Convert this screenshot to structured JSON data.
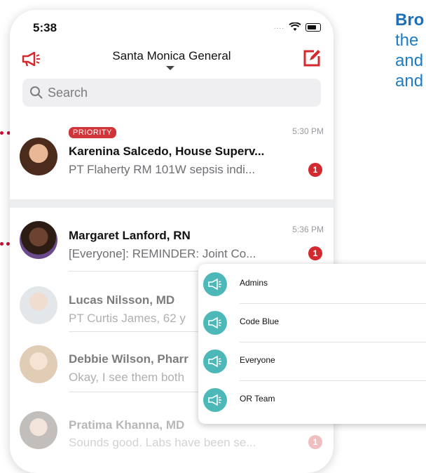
{
  "status": {
    "time": "5:38",
    "signal": "...."
  },
  "header": {
    "title": "Santa Monica General"
  },
  "search": {
    "placeholder": "Search"
  },
  "conversations": [
    {
      "tag": "PRIORITY",
      "name": "Karenina Salcedo, House Superv...",
      "preview": "PT Flaherty RM 101W sepsis indi...",
      "time": "5:30 PM",
      "unread": "1"
    },
    {
      "name": "Margaret Lanford, RN",
      "preview": "[Everyone]: REMINDER: Joint Co...",
      "time": "5:36 PM",
      "unread": "1"
    },
    {
      "name": "Lucas Nilsson, MD",
      "preview": "PT Curtis James, 62 y"
    },
    {
      "name": "Debbie Wilson, Pharr",
      "preview": "Okay, I see them both"
    },
    {
      "name": "Pratima Khanna, MD",
      "preview": "Sounds good. Labs have been se...",
      "unread": "1"
    }
  ],
  "broadcast_lists": [
    {
      "label": "Admins"
    },
    {
      "label": "Code Blue"
    },
    {
      "label": "Everyone"
    },
    {
      "label": "OR Team"
    }
  ],
  "side_text": {
    "line1": "Bro",
    "line2": "the",
    "line3": "and",
    "line4": "and"
  },
  "colors": {
    "accent_red": "#d32a2f",
    "teal": "#4db8b8",
    "blue_text": "#1d7cc4"
  }
}
